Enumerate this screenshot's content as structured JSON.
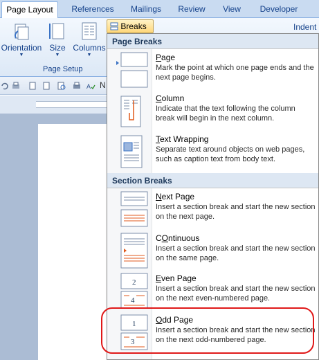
{
  "tabs": [
    "Page Layout",
    "References",
    "Mailings",
    "Review",
    "View",
    "Developer"
  ],
  "ribbon": {
    "orientation": "Orientation",
    "size": "Size",
    "columns": "Columns",
    "group_label": "Page Setup",
    "breaks": "Breaks",
    "indent": "Indent"
  },
  "menu": {
    "page_breaks_header": "Page Breaks",
    "section_breaks_header": "Section Breaks",
    "page_breaks": [
      {
        "title_u": "P",
        "title": "age",
        "desc": "Mark the point at which one page ends and the next page begins.",
        "icon": "page-break-icon"
      },
      {
        "title_u": "C",
        "title": "olumn",
        "desc": "Indicate that the text following the column break will begin in the next column.",
        "icon": "column-break-icon"
      },
      {
        "title_u": "T",
        "title": "ext Wrapping",
        "desc": "Separate text around objects on web pages, such as caption text from body text.",
        "icon": "text-wrapping-icon"
      }
    ],
    "section_breaks": [
      {
        "title_u": "N",
        "title": "ext Page",
        "desc": "Insert a section break and start the new section on the next page.",
        "icon": "next-page-icon"
      },
      {
        "title_u": "O",
        "title": "ntinuous",
        "title_prefix": "C",
        "desc": "Insert a section break and start the new section on the same page.",
        "icon": "continuous-icon"
      },
      {
        "title_u": "E",
        "title": "ven Page",
        "desc": "Insert a section break and start the new section on the next even-numbered page.",
        "icon": "even-page-icon"
      },
      {
        "title_u": "O",
        "title": "dd Page",
        "desc": "Insert a section break and start the new section on the next odd-numbered page.",
        "icon": "odd-page-icon"
      }
    ]
  },
  "qat_zoom_letter": "N",
  "colors": {
    "accent": "#e01818",
    "ribbon": "#dce8f6"
  }
}
